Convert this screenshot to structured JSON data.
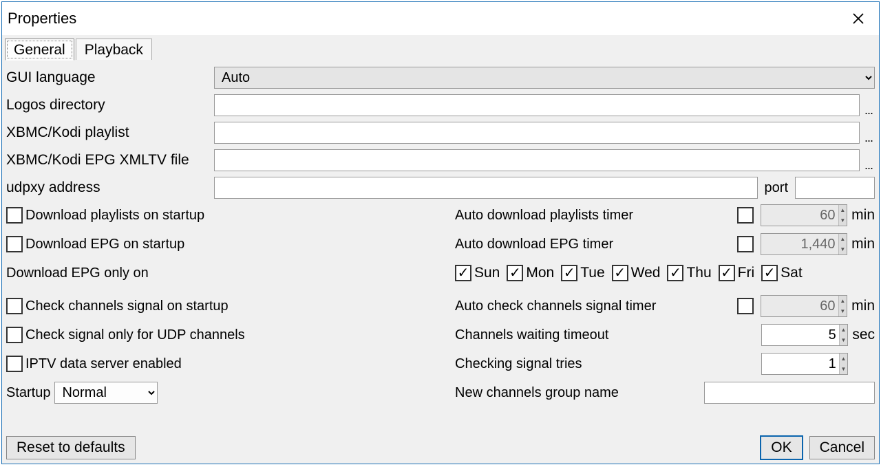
{
  "window": {
    "title": "Properties"
  },
  "tabs": [
    "General",
    "Playback"
  ],
  "active_tab": 0,
  "labels": {
    "gui_language": "GUI language",
    "logos_dir": "Logos directory",
    "kodi_playlist": "XBMC/Kodi playlist",
    "kodi_epg": "XBMC/Kodi EPG XMLTV file",
    "udpxy_addr": "udpxy address",
    "udpxy_port": "port",
    "dl_playlists_startup": "Download playlists on startup",
    "dl_epg_startup": "Download EPG on startup",
    "auto_dl_playlists_timer": "Auto download playlists timer",
    "auto_dl_epg_timer": "Auto download EPG timer",
    "dl_epg_only_on": "Download EPG only on",
    "check_signal_startup": "Check channels signal on startup",
    "check_signal_udp_only": "Check signal only for UDP channels",
    "iptv_server_enabled": "IPTV data server enabled",
    "auto_check_signal_timer": "Auto check channels signal timer",
    "channels_wait_timeout": "Channels waiting timeout",
    "checking_tries": "Checking signal tries",
    "new_group_name": "New channels group name",
    "startup": "Startup",
    "min": "min",
    "sec": "sec"
  },
  "values": {
    "gui_language": "Auto",
    "logos_dir": "",
    "kodi_playlist": "",
    "kodi_epg": "",
    "udpxy_addr": "",
    "udpxy_port": "",
    "dl_playlists_startup_checked": false,
    "dl_epg_startup_checked": false,
    "auto_dl_playlists_timer_enabled": false,
    "auto_dl_playlists_timer": "60",
    "auto_dl_epg_timer_enabled": false,
    "auto_dl_epg_timer": "1,440",
    "check_signal_startup_checked": false,
    "check_signal_udp_only_checked": false,
    "iptv_server_enabled_checked": false,
    "auto_check_signal_timer_enabled": false,
    "auto_check_signal_timer": "60",
    "channels_wait_timeout": "5",
    "checking_tries": "1",
    "new_group_name": "",
    "startup": "Normal"
  },
  "days": [
    {
      "abbr": "Sun",
      "checked": true
    },
    {
      "abbr": "Mon",
      "checked": true
    },
    {
      "abbr": "Tue",
      "checked": true
    },
    {
      "abbr": "Wed",
      "checked": true
    },
    {
      "abbr": "Thu",
      "checked": true
    },
    {
      "abbr": "Fri",
      "checked": true
    },
    {
      "abbr": "Sat",
      "checked": true
    }
  ],
  "buttons": {
    "reset": "Reset to defaults",
    "ok": "OK",
    "cancel": "Cancel"
  }
}
